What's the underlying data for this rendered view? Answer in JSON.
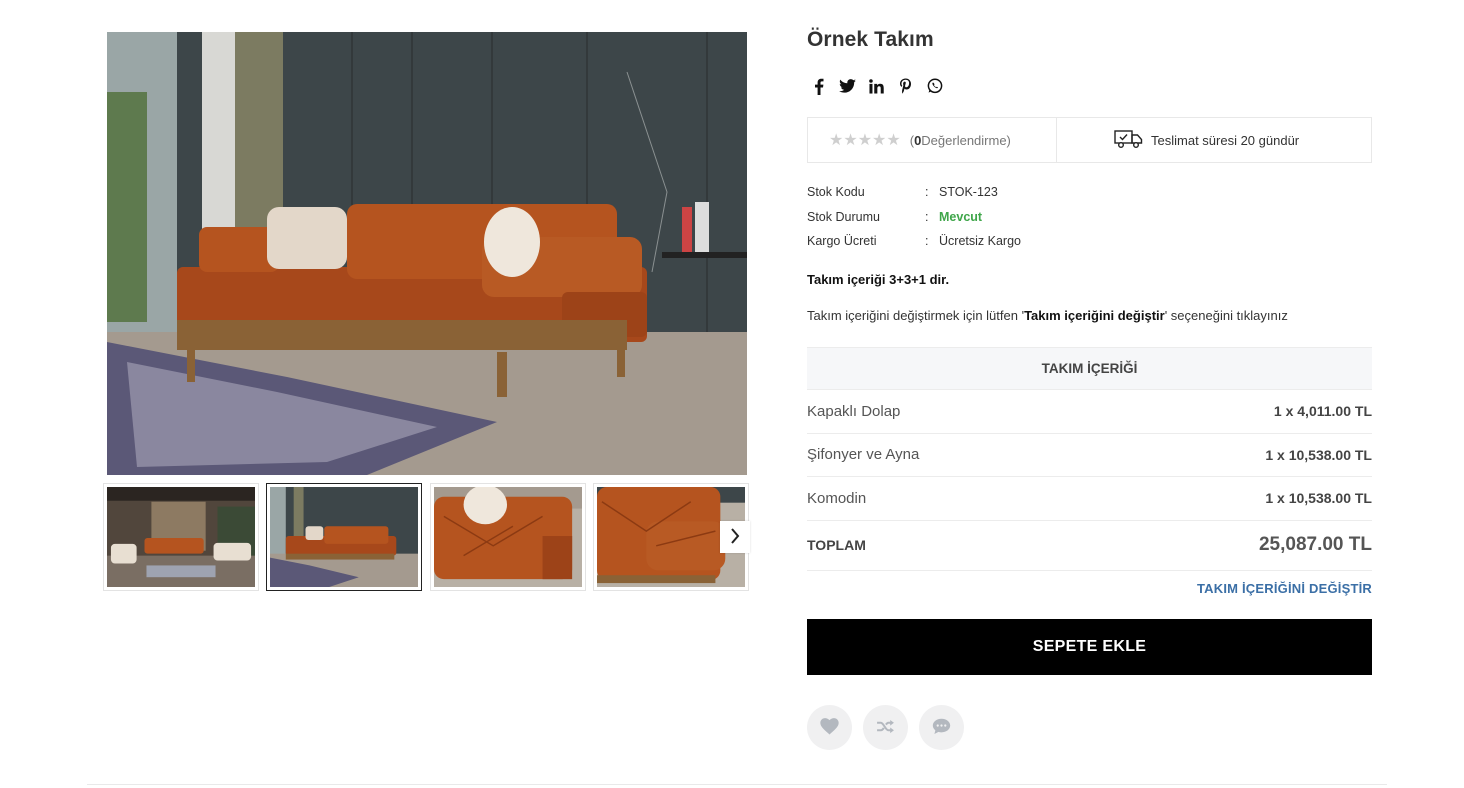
{
  "product": {
    "title": "Örnek Takım"
  },
  "social": [
    "facebook-icon",
    "twitter-icon",
    "linkedin-icon",
    "pinterest-icon",
    "whatsapp-icon"
  ],
  "rating": {
    "stars": "★★★★★",
    "filled": 0,
    "open": "(",
    "count": "0",
    "label": " Değerlendirme)"
  },
  "delivery": {
    "icon": "delivery-truck-icon",
    "text": "Teslimat süresi 20 gündür"
  },
  "specs": [
    {
      "key": "Stok Kodu",
      "sep": ":",
      "value": "STOK-123"
    },
    {
      "key": "Stok Durumu",
      "sep": ":",
      "value": "Mevcut"
    },
    {
      "key": "Kargo Ücreti",
      "sep": ":",
      "value": "Ücretsiz Kargo"
    }
  ],
  "content_note": "Takım içeriği 3+3+1 dir.",
  "change_note": {
    "pre": "Takım içeriğini değiştirmek için lütfen '",
    "bold": "Takım içeriğini değiştir",
    "post": "' seçeneğini tıklayınız"
  },
  "set_table": {
    "heading": "TAKIM İÇERİĞİ",
    "rows": [
      {
        "name": "Kapaklı Dolap",
        "price": "1 x 4,011.00 TL"
      },
      {
        "name": "Şifonyer ve Ayna",
        "price": "1 x 10,538.00 TL"
      },
      {
        "name": "Komodin",
        "price": "1 x 10,538.00 TL"
      }
    ],
    "total_label": "TOPLAM",
    "total_value": "25,087.00 TL"
  },
  "change_link": "TAKIM İÇERİĞİNİ DEĞİŞTİR",
  "add_to_cart": "SEPETE EKLE",
  "actions": [
    "heart-icon",
    "shuffle-icon",
    "comment-icon"
  ],
  "colors": {
    "accent_link": "#3b6fa6",
    "in_stock": "#3fa64a",
    "button": "#000000",
    "sofa": "#b5541f"
  }
}
